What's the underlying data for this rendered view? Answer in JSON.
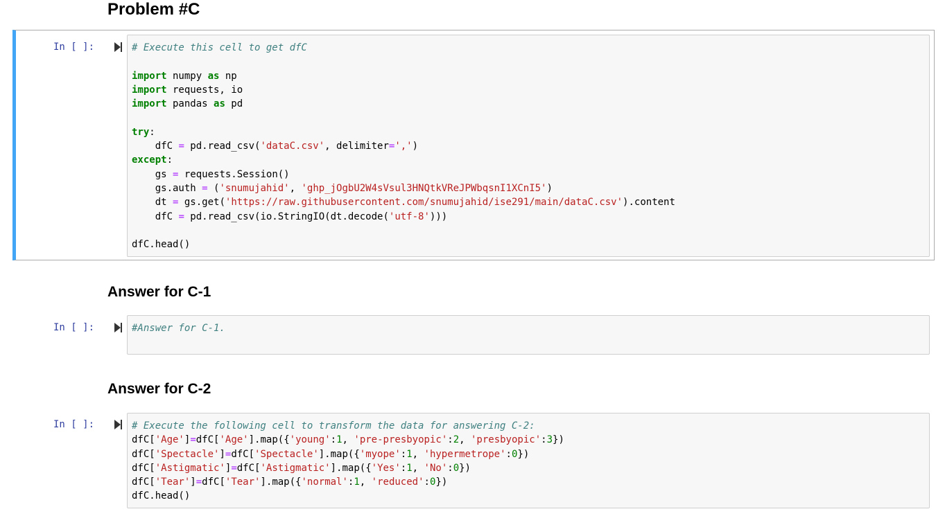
{
  "problem_heading": "Problem #C",
  "cells": [
    {
      "prompt": "In [ ]:",
      "lines": [
        [
          {
            "t": "# Execute this cell to get dfC",
            "c": "cm"
          }
        ],
        [],
        [
          {
            "t": "import",
            "c": "kw"
          },
          {
            "t": " numpy "
          },
          {
            "t": "as",
            "c": "kw"
          },
          {
            "t": " np"
          }
        ],
        [
          {
            "t": "import",
            "c": "kw"
          },
          {
            "t": " requests, io"
          }
        ],
        [
          {
            "t": "import",
            "c": "kw"
          },
          {
            "t": " pandas "
          },
          {
            "t": "as",
            "c": "kw"
          },
          {
            "t": " pd"
          }
        ],
        [],
        [
          {
            "t": "try",
            "c": "kw"
          },
          {
            "t": ":"
          }
        ],
        [
          {
            "t": "    dfC "
          },
          {
            "t": "=",
            "c": "op"
          },
          {
            "t": " pd.read_csv("
          },
          {
            "t": "'dataC.csv'",
            "c": "st"
          },
          {
            "t": ", delimiter"
          },
          {
            "t": "=",
            "c": "op"
          },
          {
            "t": "','",
            "c": "st"
          },
          {
            "t": ")"
          }
        ],
        [
          {
            "t": "except",
            "c": "kw"
          },
          {
            "t": ":"
          }
        ],
        [
          {
            "t": "    gs "
          },
          {
            "t": "=",
            "c": "op"
          },
          {
            "t": " requests.Session()"
          }
        ],
        [
          {
            "t": "    gs.auth "
          },
          {
            "t": "=",
            "c": "op"
          },
          {
            "t": " ("
          },
          {
            "t": "'snumujahid'",
            "c": "st"
          },
          {
            "t": ", "
          },
          {
            "t": "'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'",
            "c": "st"
          },
          {
            "t": ")"
          }
        ],
        [
          {
            "t": "    dt "
          },
          {
            "t": "=",
            "c": "op"
          },
          {
            "t": " gs.get("
          },
          {
            "t": "'https://raw.githubusercontent.com/snumujahid/ise291/main/dataC.csv'",
            "c": "st"
          },
          {
            "t": ").content"
          }
        ],
        [
          {
            "t": "    dfC "
          },
          {
            "t": "=",
            "c": "op"
          },
          {
            "t": " pd.read_csv(io.StringIO(dt.decode("
          },
          {
            "t": "'utf-8'",
            "c": "st"
          },
          {
            "t": ")))"
          }
        ],
        [],
        [
          {
            "t": "dfC.head()"
          }
        ]
      ]
    },
    {
      "heading": "Answer for C-1",
      "prompt": "In [ ]:",
      "lines": [
        [
          {
            "t": "#Answer for C-1.",
            "c": "cm"
          }
        ]
      ]
    },
    {
      "heading": "Answer for C-2",
      "prompt": "In [ ]:",
      "lines": [
        [
          {
            "t": "# Execute the following cell to transform the data for answering C-2:",
            "c": "cm"
          }
        ],
        [
          {
            "t": "dfC["
          },
          {
            "t": "'Age'",
            "c": "st"
          },
          {
            "t": "]"
          },
          {
            "t": "=",
            "c": "op"
          },
          {
            "t": "dfC["
          },
          {
            "t": "'Age'",
            "c": "st"
          },
          {
            "t": "].map({"
          },
          {
            "t": "'young'",
            "c": "st"
          },
          {
            "t": ":"
          },
          {
            "t": "1",
            "c": "nu"
          },
          {
            "t": ", "
          },
          {
            "t": "'pre-presbyopic'",
            "c": "st"
          },
          {
            "t": ":"
          },
          {
            "t": "2",
            "c": "nu"
          },
          {
            "t": ", "
          },
          {
            "t": "'presbyopic'",
            "c": "st"
          },
          {
            "t": ":"
          },
          {
            "t": "3",
            "c": "nu"
          },
          {
            "t": "})"
          }
        ],
        [
          {
            "t": "dfC["
          },
          {
            "t": "'Spectacle'",
            "c": "st"
          },
          {
            "t": "]"
          },
          {
            "t": "=",
            "c": "op"
          },
          {
            "t": "dfC["
          },
          {
            "t": "'Spectacle'",
            "c": "st"
          },
          {
            "t": "].map({"
          },
          {
            "t": "'myope'",
            "c": "st"
          },
          {
            "t": ":"
          },
          {
            "t": "1",
            "c": "nu"
          },
          {
            "t": ", "
          },
          {
            "t": "'hypermetrope'",
            "c": "st"
          },
          {
            "t": ":"
          },
          {
            "t": "0",
            "c": "nu"
          },
          {
            "t": "})"
          }
        ],
        [
          {
            "t": "dfC["
          },
          {
            "t": "'Astigmatic'",
            "c": "st"
          },
          {
            "t": "]"
          },
          {
            "t": "=",
            "c": "op"
          },
          {
            "t": "dfC["
          },
          {
            "t": "'Astigmatic'",
            "c": "st"
          },
          {
            "t": "].map({"
          },
          {
            "t": "'Yes'",
            "c": "st"
          },
          {
            "t": ":"
          },
          {
            "t": "1",
            "c": "nu"
          },
          {
            "t": ", "
          },
          {
            "t": "'No'",
            "c": "st"
          },
          {
            "t": ":"
          },
          {
            "t": "0",
            "c": "nu"
          },
          {
            "t": "})"
          }
        ],
        [
          {
            "t": "dfC["
          },
          {
            "t": "'Tear'",
            "c": "st"
          },
          {
            "t": "]"
          },
          {
            "t": "=",
            "c": "op"
          },
          {
            "t": "dfC["
          },
          {
            "t": "'Tear'",
            "c": "st"
          },
          {
            "t": "].map({"
          },
          {
            "t": "'normal'",
            "c": "st"
          },
          {
            "t": ":"
          },
          {
            "t": "1",
            "c": "nu"
          },
          {
            "t": ", "
          },
          {
            "t": "'reduced'",
            "c": "st"
          },
          {
            "t": ":"
          },
          {
            "t": "0",
            "c": "nu"
          },
          {
            "t": "})"
          }
        ],
        [
          {
            "t": "dfC.head()"
          }
        ]
      ]
    }
  ],
  "colors": {
    "selected_bar": "#42a5f5",
    "prompt": "#303f9f",
    "comment": "#408080",
    "keyword": "#008000",
    "string": "#ba2121",
    "operator": "#aa22ff"
  },
  "icons": {
    "run": "run-cell-icon"
  }
}
